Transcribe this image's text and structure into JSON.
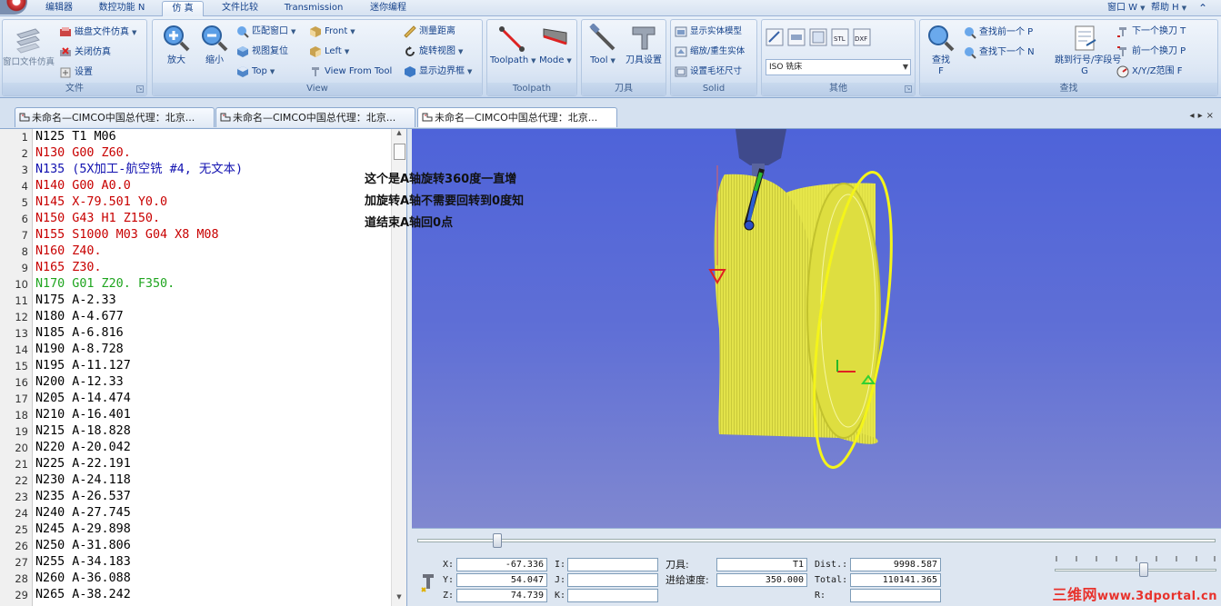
{
  "menu_tabs": [
    "编辑器",
    "数控功能 N",
    "仿 真",
    "文件比较",
    "Transmission",
    "迷你编程"
  ],
  "menu_right": {
    "window": "窗口 W",
    "help": "帮助 H"
  },
  "ribbon": {
    "file_group": {
      "title": "文件",
      "window_file_sim": "窗口文件仿真",
      "disk_file_sim": "磁盘文件仿真",
      "close_sim": "关闭仿真",
      "settings": "设置"
    },
    "view_group": {
      "title": "View",
      "zoom_in": "放大",
      "zoom_out": "缩小",
      "fit_window": "匹配窗口",
      "view_reset": "视图复位",
      "top": "Top",
      "front": "Front",
      "left": "Left",
      "view_from_tool": "View From Tool",
      "measure": "测量距离",
      "rotate_view": "旋转视图",
      "show_bounds": "显示边界框"
    },
    "toolpath_group": {
      "title": "Toolpath",
      "toolpath": "Toolpath",
      "mode": "Mode"
    },
    "tool_group": {
      "title": "刀具",
      "tool": "Tool",
      "tool_settings": "刀具设置"
    },
    "solid_group": {
      "title": "Solid",
      "show_solid": "显示实体模型",
      "scale_regen": "缩放/重生实体",
      "stock_size": "设置毛坯尺寸"
    },
    "other_group": {
      "title": "其他",
      "machine_select": "ISO 铣床"
    },
    "find_group": {
      "title": "查找",
      "find": "查找",
      "find_key": "F",
      "find_prev": "查找前一个 P",
      "find_next": "查找下一个 N",
      "goto_line": "跳到行号/字段号",
      "goto_key": "G",
      "next_tool_change": "下一个换刀 T",
      "prev_tool_change": "前一个换刀 P",
      "xyz_range": "X/Y/Z范围 F"
    }
  },
  "doc_tabs": [
    "未命名—CIMCO中国总代理：北京...",
    "未命名—CIMCO中国总代理：北京...",
    "未命名—CIMCO中国总代理：北京..."
  ],
  "editor_lines": [
    {
      "n": "1",
      "text": "N125 T1 M06",
      "color": "#000000"
    },
    {
      "n": "2",
      "text": "N130 G00 Z60.",
      "color": "#c80000"
    },
    {
      "n": "3",
      "text": "N135 (5X加工-航空铣 #4, 无文本)",
      "color": "#1212b0"
    },
    {
      "n": "4",
      "text": "N140 G00 A0.0",
      "color": "#c80000"
    },
    {
      "n": "5",
      "text": "N145 X-79.501 Y0.0",
      "color": "#c80000"
    },
    {
      "n": "6",
      "text": "N150 G43 H1 Z150.",
      "color": "#c80000"
    },
    {
      "n": "7",
      "text": "N155 S1000 M03 G04 X8 M08",
      "color": "#c80000"
    },
    {
      "n": "8",
      "text": "N160 Z40.",
      "color": "#c80000"
    },
    {
      "n": "9",
      "text": "N165 Z30.",
      "color": "#c80000"
    },
    {
      "n": "10",
      "text": "N170 G01 Z20. F350.",
      "color": "#1fa51f"
    },
    {
      "n": "11",
      "text": "N175 A-2.33",
      "color": "#000000"
    },
    {
      "n": "12",
      "text": "N180 A-4.677",
      "color": "#000000"
    },
    {
      "n": "13",
      "text": "N185 A-6.816",
      "color": "#000000"
    },
    {
      "n": "14",
      "text": "N190 A-8.728",
      "color": "#000000"
    },
    {
      "n": "15",
      "text": "N195 A-11.127",
      "color": "#000000"
    },
    {
      "n": "16",
      "text": "N200 A-12.33",
      "color": "#000000"
    },
    {
      "n": "17",
      "text": "N205 A-14.474",
      "color": "#000000"
    },
    {
      "n": "18",
      "text": "N210 A-16.401",
      "color": "#000000"
    },
    {
      "n": "19",
      "text": "N215 A-18.828",
      "color": "#000000"
    },
    {
      "n": "20",
      "text": "N220 A-20.042",
      "color": "#000000"
    },
    {
      "n": "21",
      "text": "N225 A-22.191",
      "color": "#000000"
    },
    {
      "n": "22",
      "text": "N230 A-24.118",
      "color": "#000000"
    },
    {
      "n": "23",
      "text": "N235 A-26.537",
      "color": "#000000"
    },
    {
      "n": "24",
      "text": "N240 A-27.745",
      "color": "#000000"
    },
    {
      "n": "25",
      "text": "N245 A-29.898",
      "color": "#000000"
    },
    {
      "n": "26",
      "text": "N250 A-31.806",
      "color": "#000000"
    },
    {
      "n": "27",
      "text": "N255 A-34.183",
      "color": "#000000"
    },
    {
      "n": "28",
      "text": "N260 A-36.088",
      "color": "#000000"
    },
    {
      "n": "29",
      "text": "N265 A-38.242",
      "color": "#000000"
    }
  ],
  "annotation": [
    "这个是A轴旋转360度一直增",
    "加旋转A轴不需要回转到0度知",
    "道结束A轴回0点"
  ],
  "readout": {
    "x_label": "X:",
    "x": "-67.336",
    "y_label": "Y:",
    "y": "54.047",
    "z_label": "Z:",
    "z": "74.739",
    "i_label": "I:",
    "i": "",
    "j_label": "J:",
    "j": "",
    "k_label": "K:",
    "k": "",
    "tool_label": "刀具:",
    "tool": "T1",
    "feed_label": "进给速度:",
    "feed": "350.000",
    "dist_label": "Dist.:",
    "dist": "9998.587",
    "total_label": "Total:",
    "total": "110141.365",
    "r_label": "R:",
    "r": ""
  },
  "sim_progress": 0.1,
  "speed_level": 0.55,
  "watermark": {
    "main": "三维网",
    "sub": "www.3dportal.cn"
  },
  "colors": {
    "viewport_top": "#4e63d9",
    "part": "#e8e84a",
    "ellipse": "#f2f21e",
    "tool_body": "#3f4a8c"
  }
}
